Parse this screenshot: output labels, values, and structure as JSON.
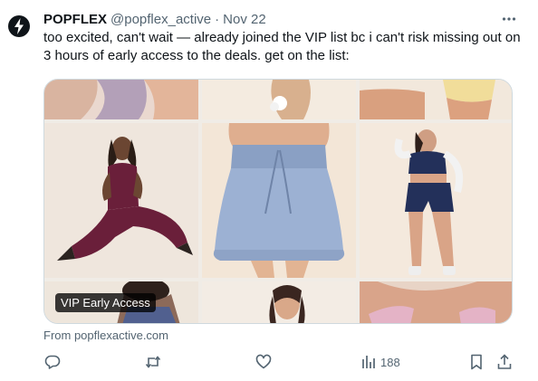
{
  "author": {
    "name": "POPFLEX",
    "handle": "@popflex_active",
    "separator": "·",
    "date": "Nov 22"
  },
  "tweet_text": "too excited, can't wait — already joined the VIP list bc i can't risk missing out on 3 hours of early access to the deals. get on the list:",
  "card": {
    "badge": "VIP Early Access",
    "source": "From popflexactive.com"
  },
  "actions": {
    "views_count": "188"
  },
  "icons": [
    "more-icon",
    "reply-icon",
    "retweet-icon",
    "like-icon",
    "views-icon",
    "bookmark-icon",
    "share-icon",
    "popflex-logo"
  ],
  "colors": {
    "text_primary": "#0f1419",
    "text_secondary": "#536471",
    "border": "#cfd9de"
  }
}
